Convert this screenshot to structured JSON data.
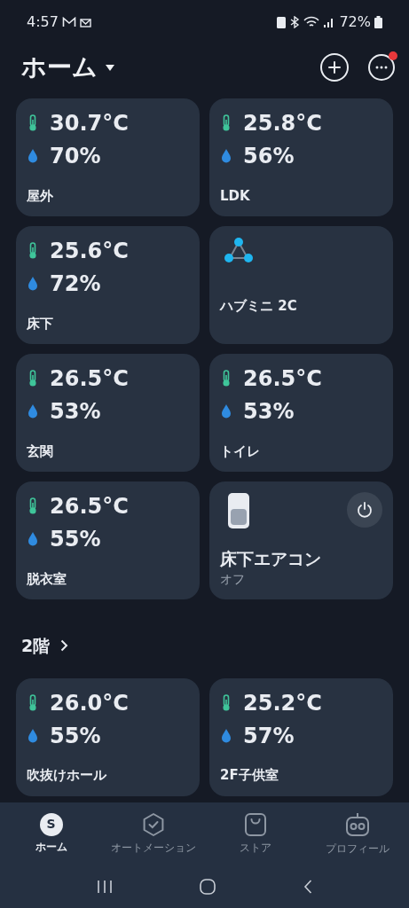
{
  "status_bar": {
    "time": "4:57",
    "battery": "72%"
  },
  "header": {
    "title": "ホーム",
    "notification_dot": true
  },
  "devices": [
    {
      "kind": "sensor",
      "temperature": "30.7°C",
      "humidity": "70%",
      "name": "屋外"
    },
    {
      "kind": "sensor",
      "temperature": "25.8°C",
      "humidity": "56%",
      "name": "LDK"
    },
    {
      "kind": "sensor",
      "temperature": "25.6°C",
      "humidity": "72%",
      "name": "床下"
    },
    {
      "kind": "hub",
      "name": "ハブミニ 2C"
    },
    {
      "kind": "sensor",
      "temperature": "26.5°C",
      "humidity": "53%",
      "name": "玄関"
    },
    {
      "kind": "sensor",
      "temperature": "26.5°C",
      "humidity": "53%",
      "name": "トイレ"
    },
    {
      "kind": "sensor",
      "temperature": "26.5°C",
      "humidity": "55%",
      "name": "脱衣室"
    },
    {
      "kind": "switch",
      "name": "床下エアコン",
      "status": "オフ",
      "on": false
    }
  ],
  "section": {
    "title": "2階"
  },
  "section_devices": [
    {
      "kind": "sensor",
      "temperature": "26.0°C",
      "humidity": "55%",
      "name": "吹抜けホール"
    },
    {
      "kind": "sensor",
      "temperature": "25.2°C",
      "humidity": "57%",
      "name": "2F子供室"
    }
  ],
  "tabs": [
    {
      "kind": "home",
      "label": "ホーム",
      "icon_letter": "S",
      "selected": true
    },
    {
      "kind": "automation",
      "label": "オートメーション",
      "selected": false
    },
    {
      "kind": "store",
      "label": "ストア",
      "selected": false
    },
    {
      "kind": "profile",
      "label": "プロフィール",
      "selected": false
    }
  ]
}
